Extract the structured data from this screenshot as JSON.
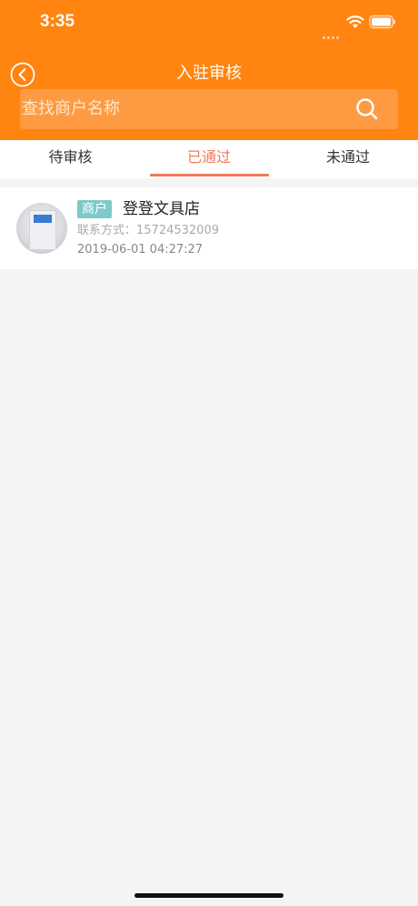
{
  "status_bar": {
    "time": "3:35"
  },
  "nav": {
    "title": "入驻审核",
    "search_placeholder": "查找商户名称"
  },
  "tabs": [
    {
      "label": "待审核",
      "active": false
    },
    {
      "label": "已通过",
      "active": true
    },
    {
      "label": "未通过",
      "active": false
    }
  ],
  "items": [
    {
      "badge": "商户",
      "name": "登登文具店",
      "contact": "联系方式：15724532009",
      "datetime": "2019-06-01 04:27:27"
    }
  ],
  "colors": {
    "header": "#ff8410",
    "accent": "#f07a55",
    "badge": "#7ec9c9",
    "background": "#f4f4f4"
  }
}
